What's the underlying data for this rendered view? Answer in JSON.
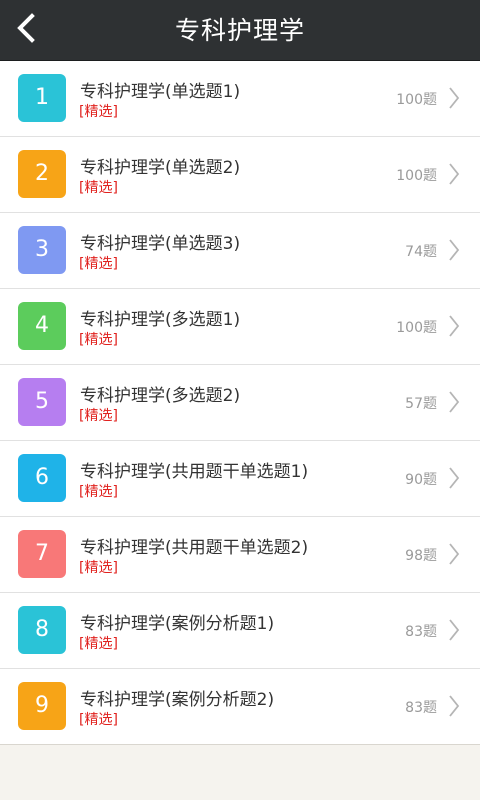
{
  "header": {
    "title": "专科护理学",
    "back_icon": "chevron-left-icon"
  },
  "colors": {
    "header_bg": "#2e3133",
    "tag_red": "#e0211e"
  },
  "items": [
    {
      "number": "1",
      "title": "专科护理学(单选题1)",
      "tag": "[精选]",
      "count": "100题",
      "color": "#2ac3d7"
    },
    {
      "number": "2",
      "title": "专科护理学(单选题2)",
      "tag": "[精选]",
      "count": "100题",
      "color": "#f7a417"
    },
    {
      "number": "3",
      "title": "专科护理学(单选题3)",
      "tag": "[精选]",
      "count": "74题",
      "color": "#7f99f2"
    },
    {
      "number": "4",
      "title": "专科护理学(多选题1)",
      "tag": "[精选]",
      "count": "100题",
      "color": "#5ccc5c"
    },
    {
      "number": "5",
      "title": "专科护理学(多选题2)",
      "tag": "[精选]",
      "count": "57题",
      "color": "#b67ef0"
    },
    {
      "number": "6",
      "title": "专科护理学(共用题干单选题1)",
      "tag": "[精选]",
      "count": "90题",
      "color": "#1fb3e8"
    },
    {
      "number": "7",
      "title": "专科护理学(共用题干单选题2)",
      "tag": "[精选]",
      "count": "98题",
      "color": "#f87878"
    },
    {
      "number": "8",
      "title": "专科护理学(案例分析题1)",
      "tag": "[精选]",
      "count": "83题",
      "color": "#2ac3d7"
    },
    {
      "number": "9",
      "title": "专科护理学(案例分析题2)",
      "tag": "[精选]",
      "count": "83题",
      "color": "#f7a417"
    }
  ]
}
